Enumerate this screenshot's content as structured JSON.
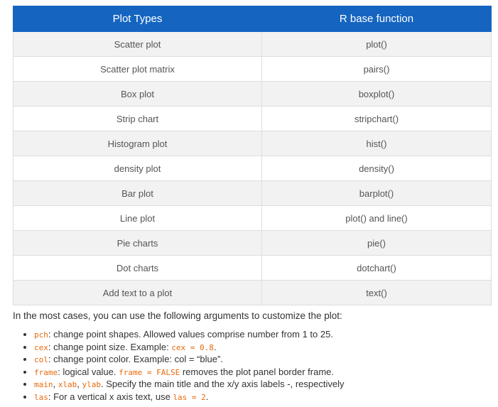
{
  "table": {
    "headers": [
      "Plot Types",
      "R base function"
    ],
    "rows": [
      [
        "Scatter plot",
        "plot()"
      ],
      [
        "Scatter plot matrix",
        "pairs()"
      ],
      [
        "Box plot",
        "boxplot()"
      ],
      [
        "Strip chart",
        "stripchart()"
      ],
      [
        "Histogram plot",
        "hist()"
      ],
      [
        "density plot",
        "density()"
      ],
      [
        "Bar plot",
        "barplot()"
      ],
      [
        "Line plot",
        "plot() and line()"
      ],
      [
        "Pie charts",
        "pie()"
      ],
      [
        "Dot charts",
        "dotchart()"
      ],
      [
        "Add text to a plot",
        "text()"
      ]
    ]
  },
  "intro": "In the most cases, you can use the following arguments to customize the plot:",
  "arguments": [
    [
      {
        "code": "pch"
      },
      {
        "text": ": change point shapes. Allowed values comprise number from 1 to 25."
      }
    ],
    [
      {
        "code": "cex"
      },
      {
        "text": ": change point size. Example: "
      },
      {
        "code": "cex = 0.8"
      },
      {
        "text": "."
      }
    ],
    [
      {
        "code": "col"
      },
      {
        "text": ": change point color. Example: col = “blue”."
      }
    ],
    [
      {
        "code": "frame"
      },
      {
        "text": ": logical value. "
      },
      {
        "code": "frame = FALSE"
      },
      {
        "text": " removes the plot panel border frame."
      }
    ],
    [
      {
        "code": "main"
      },
      {
        "text": ", "
      },
      {
        "code": "xlab"
      },
      {
        "text": ", "
      },
      {
        "code": "ylab"
      },
      {
        "text": ". Specify the main title and the x/y axis labels -, respectively"
      }
    ],
    [
      {
        "code": "las"
      },
      {
        "text": ": For a vertical x axis text, use "
      },
      {
        "code": "las = 2"
      },
      {
        "text": "."
      }
    ]
  ],
  "colors": {
    "header_bg": "#1565c0",
    "header_text": "#ffffff",
    "row_stripe": "#f2f2f2",
    "code_text": "#e8690c"
  }
}
